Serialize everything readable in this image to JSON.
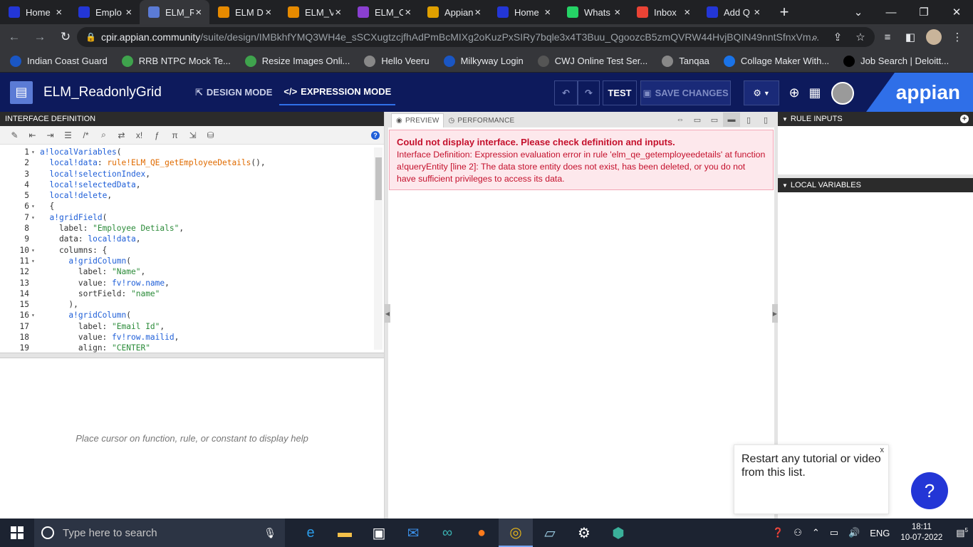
{
  "browser": {
    "tabs": [
      {
        "title": "Home",
        "icon": "appian-icon",
        "color": "#2336d6"
      },
      {
        "title": "Emplo",
        "icon": "grid-icon",
        "color": "#2336d6"
      },
      {
        "title": "ELM_R",
        "icon": "interface-icon",
        "color": "#5b7bd5",
        "active": true
      },
      {
        "title": "ELM D",
        "icon": "doc-icon",
        "color": "#e68a00"
      },
      {
        "title": "ELM_V",
        "icon": "doc-icon",
        "color": "#e68a00"
      },
      {
        "title": "ELM_C",
        "icon": "code-icon",
        "color": "#8a3fd1"
      },
      {
        "title": "Appian",
        "icon": "appian-a-icon",
        "color": "#e0a000"
      },
      {
        "title": "Home",
        "icon": "appian-icon",
        "color": "#2336d6"
      },
      {
        "title": "Whats",
        "icon": "whatsapp-icon",
        "color": "#25d366"
      },
      {
        "title": "Inbox",
        "icon": "gmail-icon",
        "color": "#ea4335"
      },
      {
        "title": "Add Q",
        "icon": "appian-icon",
        "color": "#2336d6"
      }
    ],
    "url_host": "cpir.appian.community",
    "url_path": "/suite/design/IMBkhfYMQ3WH4e_sSCXugtzcjfhAdPmBcMIXg2oKuzPxSIRy7bqle3x4T3Buu_QgoozcB5zmQVRW44HvjBQIN49nntSfnxVm...",
    "bookmarks": [
      {
        "label": "Indian Coast Guard",
        "color": "#1a56c4"
      },
      {
        "label": "RRB NTPC Mock Te...",
        "color": "#3fa34d"
      },
      {
        "label": "Resize Images Onli...",
        "color": "#3fa34d"
      },
      {
        "label": "Hello Veeru",
        "color": "#888888"
      },
      {
        "label": "Milkyway Login",
        "color": "#1a56c4"
      },
      {
        "label": "CWJ Online Test Ser...",
        "color": "#555555"
      },
      {
        "label": "Tanqaa",
        "color": "#888888"
      },
      {
        "label": "Collage Maker With...",
        "color": "#1a73e8"
      },
      {
        "label": "Job Search | Deloitt...",
        "color": "#000000"
      }
    ]
  },
  "appheader": {
    "title": "ELM_ReadonlyGrid",
    "design_mode": "DESIGN MODE",
    "expression_mode": "EXPRESSION MODE",
    "test": "TEST",
    "save": "SAVE CHANGES",
    "brand": "appian"
  },
  "left": {
    "header": "INTERFACE DEFINITION",
    "help_text": "Place cursor on function, rule, or constant to display help",
    "code": [
      {
        "n": "1",
        "fold": "▾",
        "html": "<span class='k'>a!localVariables</span>("
      },
      {
        "n": "2",
        "fold": "",
        "html": "  <span class='k'>local!data</span>: <span class='r'>rule!ELM_QE_getEmployeeDetails</span>(),"
      },
      {
        "n": "3",
        "fold": "",
        "html": "  <span class='k'>local!selectionIndex</span>,"
      },
      {
        "n": "4",
        "fold": "",
        "html": "  <span class='k'>local!selectedData</span>,"
      },
      {
        "n": "5",
        "fold": "",
        "html": "  <span class='k'>local!delete</span>,"
      },
      {
        "n": "6",
        "fold": "▾",
        "html": "  {"
      },
      {
        "n": "7",
        "fold": "▾",
        "html": "  <span class='k'>a!gridField</span>("
      },
      {
        "n": "8",
        "fold": "",
        "html": "    label: <span class='s'>\"Employee Detials\"</span>,"
      },
      {
        "n": "9",
        "fold": "",
        "html": "    data: <span class='k'>local!data</span>,"
      },
      {
        "n": "10",
        "fold": "▾",
        "html": "    columns: {"
      },
      {
        "n": "11",
        "fold": "▾",
        "html": "      <span class='k'>a!gridColumn</span>("
      },
      {
        "n": "12",
        "fold": "",
        "html": "        label: <span class='s'>\"Name\"</span>,"
      },
      {
        "n": "13",
        "fold": "",
        "html": "        value: <span class='k'>fv!row.name</span>,"
      },
      {
        "n": "14",
        "fold": "",
        "html": "        sortField: <span class='s'>\"name\"</span>"
      },
      {
        "n": "15",
        "fold": "",
        "html": "      ),"
      },
      {
        "n": "16",
        "fold": "▾",
        "html": "      <span class='k'>a!gridColumn</span>("
      },
      {
        "n": "17",
        "fold": "",
        "html": "        label: <span class='s'>\"Email Id\"</span>,"
      },
      {
        "n": "18",
        "fold": "",
        "html": "        value: <span class='k'>fv!row.mailid</span>,"
      },
      {
        "n": "19",
        "fold": "",
        "html": "        align: <span class='s'>\"CENTER\"</span>"
      }
    ]
  },
  "preview": {
    "tab_preview": "PREVIEW",
    "tab_performance": "PERFORMANCE",
    "error_title": "Could not display interface. Please check definition and inputs.",
    "error_body": "Interface Definition: Expression evaluation error in rule 'elm_qe_getemployeedetails' at function a!queryEntity [line 2]: The data store entity does not exist, has been deleted, or you do not have sufficient privileges to access its data."
  },
  "right": {
    "rule_inputs": "RULE INPUTS",
    "local_variables": "LOCAL VARIABLES"
  },
  "tooltip": {
    "text": "Restart any tutorial or video from this list.",
    "close": "x"
  },
  "taskbar": {
    "search_placeholder": "Type here to search",
    "lang": "ENG",
    "time": "18:11",
    "date": "10-07-2022",
    "notif_count": "5"
  }
}
